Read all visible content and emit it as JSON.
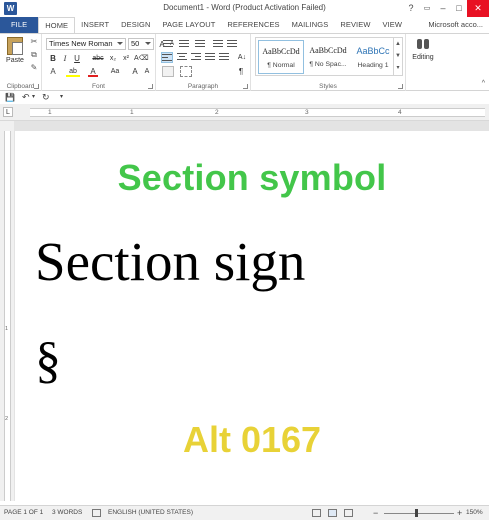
{
  "window": {
    "title": "Document1 - Word (Product Activation Failed)",
    "logo_letter": "W",
    "help": "?",
    "minimize": "–",
    "close": "✕"
  },
  "tabs": [
    "FILE",
    "HOME",
    "INSERT",
    "DESIGN",
    "PAGE LAYOUT",
    "REFERENCES",
    "MAILINGS",
    "REVIEW",
    "VIEW"
  ],
  "account": "Microsoft acco...",
  "ribbon": {
    "clipboard": {
      "paste_label": "Paste",
      "group_label": "Clipboard"
    },
    "font": {
      "font_name": "Times New Roman",
      "font_size": "50",
      "group_label": "Font",
      "grow": "A",
      "shrink": "A",
      "case": "Aa",
      "bold": "B",
      "italic": "I",
      "underline": "U",
      "strike": "abc",
      "subscript": "x₂",
      "superscript": "x²",
      "font_color": "A",
      "highlight": "ab"
    },
    "paragraph": {
      "group_label": "Paragraph",
      "sort": "A↓",
      "pilcrow": "¶"
    },
    "styles": {
      "group_label": "Styles",
      "items": [
        {
          "preview": "AaBbCcDd",
          "name": "¶ Normal"
        },
        {
          "preview": "AaBbCcDd",
          "name": "¶ No Spac..."
        },
        {
          "preview": "AaBbCc",
          "name": "Heading 1"
        }
      ]
    },
    "editing": {
      "label": "Editing"
    },
    "collapse": "^"
  },
  "qat": {
    "save": "💾",
    "undo": "↶",
    "redo": "↻",
    "customize": "▾"
  },
  "ruler": {
    "tab_selector": "L",
    "numbers": [
      "1",
      "1",
      "2",
      "3",
      "4"
    ],
    "vertical_numbers": [
      "1",
      "2"
    ]
  },
  "document": {
    "heading": "Section symbol",
    "sign_text": "Section sign",
    "symbol": "§",
    "alt_code": "Alt 0167"
  },
  "status": {
    "page": "PAGE 1 OF 1",
    "words": "3 WORDS",
    "language": "ENGLISH (UNITED STATES)",
    "zoom_minus": "−",
    "zoom_plus": "+",
    "zoom": "150%",
    "zoom_level_percent": 150
  },
  "colors": {
    "file_tab": "#2b579a",
    "close_button": "#e81123",
    "heading_green": "#43c64a",
    "alt_yellow": "#e8d237"
  }
}
